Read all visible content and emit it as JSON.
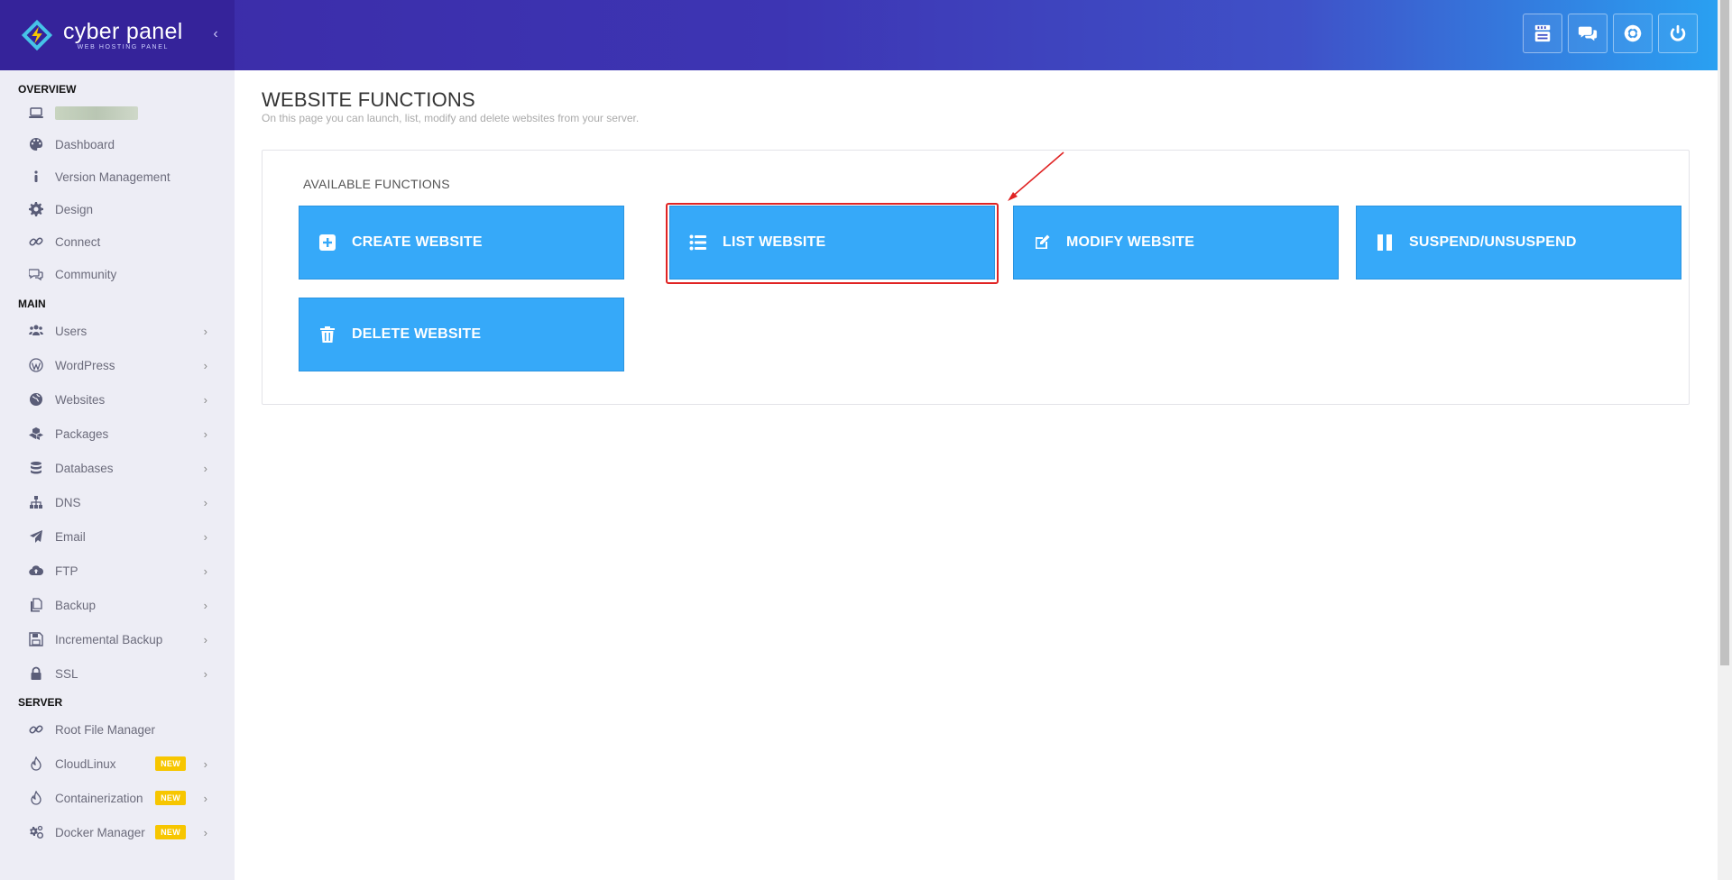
{
  "brand": {
    "title": "cyber panel",
    "subtitle": "WEB HOSTING PANEL",
    "collapse_glyph": "‹"
  },
  "top_actions": [
    {
      "name": "youtube-icon",
      "label": "YouTube"
    },
    {
      "name": "chat-icon",
      "label": "Chat"
    },
    {
      "name": "support-icon",
      "label": "Support"
    },
    {
      "name": "power-icon",
      "label": "Logout"
    }
  ],
  "sidebar": {
    "sections": {
      "overview": "OVERVIEW",
      "main": "MAIN",
      "server": "SERVER"
    },
    "overview_items": [
      {
        "label": "Dashboard",
        "icon": "palette-icon"
      },
      {
        "label": "Version Management",
        "icon": "info-icon"
      },
      {
        "label": "Design",
        "icon": "gear-icon"
      },
      {
        "label": "Connect",
        "icon": "link-icon"
      },
      {
        "label": "Community",
        "icon": "comments-icon"
      }
    ],
    "main_items": [
      {
        "label": "Users",
        "icon": "users-icon"
      },
      {
        "label": "WordPress",
        "icon": "wordpress-icon"
      },
      {
        "label": "Websites",
        "icon": "globe-icon"
      },
      {
        "label": "Packages",
        "icon": "cubes-icon"
      },
      {
        "label": "Databases",
        "icon": "database-icon"
      },
      {
        "label": "DNS",
        "icon": "sitemap-icon"
      },
      {
        "label": "Email",
        "icon": "paper-plane-icon"
      },
      {
        "label": "FTP",
        "icon": "cloud-upload-icon"
      },
      {
        "label": "Backup",
        "icon": "copy-icon"
      },
      {
        "label": "Incremental Backup",
        "icon": "save-icon"
      },
      {
        "label": "SSL",
        "icon": "lock-icon"
      }
    ],
    "server_items": [
      {
        "label": "Root File Manager",
        "icon": "link-icon"
      },
      {
        "label": "CloudLinux",
        "icon": "fire-icon",
        "badge": "NEW"
      },
      {
        "label": "Containerization",
        "icon": "fire-icon",
        "badge": "NEW"
      },
      {
        "label": "Docker Manager",
        "icon": "cogs-icon",
        "badge": "NEW"
      }
    ],
    "chevron": "›"
  },
  "main": {
    "title": "WEBSITE FUNCTIONS",
    "subtitle": "On this page you can launch, list, modify and delete websites from your server.",
    "panel_title": "AVAILABLE FUNCTIONS",
    "functions": [
      {
        "label": "CREATE WEBSITE",
        "icon": "plus-square-icon"
      },
      {
        "label": "LIST WEBSITE",
        "icon": "list-icon"
      },
      {
        "label": "MODIFY WEBSITE",
        "icon": "edit-icon"
      },
      {
        "label": "SUSPEND/UNSUSPEND",
        "icon": "pause-icon"
      },
      {
        "label": "DELETE WEBSITE",
        "icon": "trash-icon"
      }
    ]
  },
  "colors": {
    "accent": "#36a9f9",
    "highlight": "#e02424",
    "badge": "#f7c600"
  }
}
